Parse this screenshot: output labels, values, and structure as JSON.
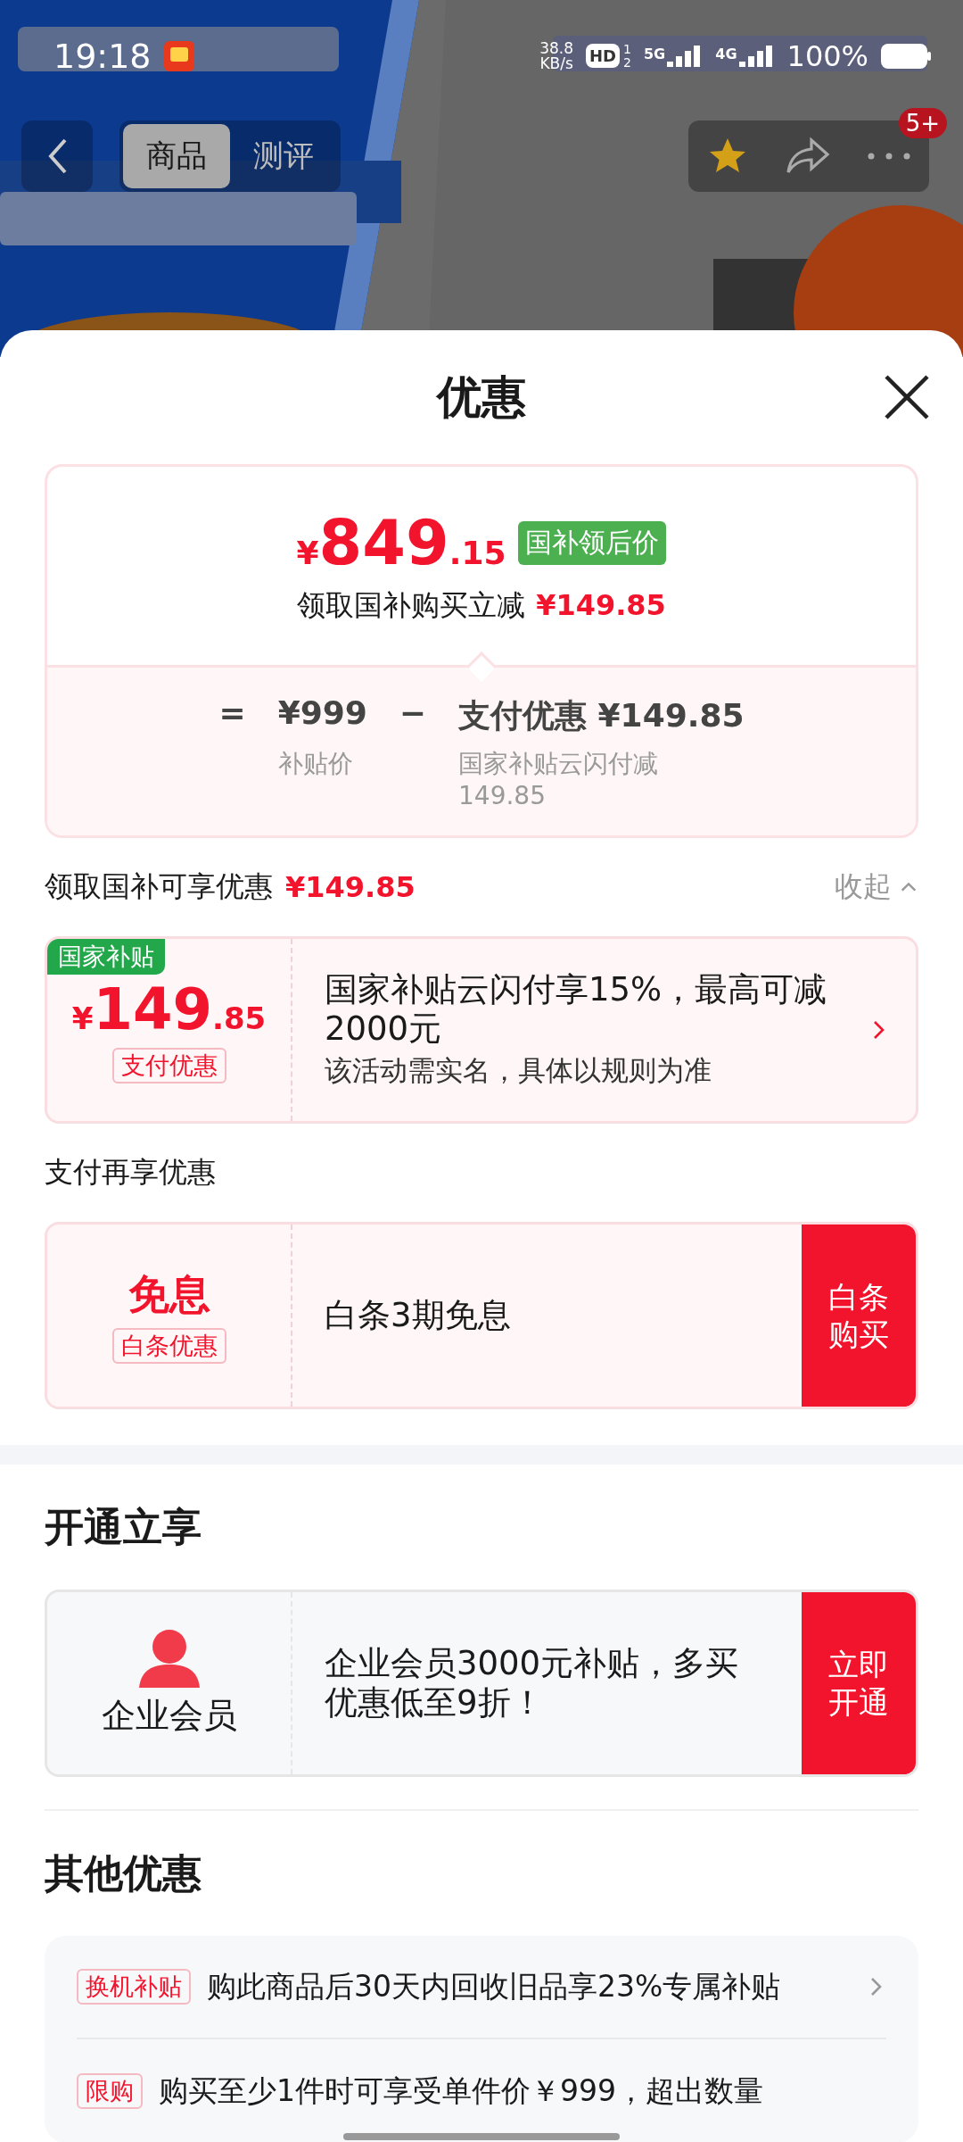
{
  "status_bar": {
    "time": "19:18",
    "net_speed": "38.8",
    "net_unit": "KB/s",
    "hd": "HD",
    "sims": [
      "1",
      "2"
    ],
    "networks": [
      "5G",
      "4G"
    ],
    "battery": "100%"
  },
  "nav": {
    "tabs": [
      {
        "label": "商品",
        "selected": true
      },
      {
        "label": "测评",
        "selected": false
      }
    ],
    "badge": "5+"
  },
  "sheet": {
    "title": "优惠",
    "price_card": {
      "currency": "¥",
      "integer": "849",
      "decimals": ".15",
      "tag": "国补领后价",
      "subtitle": "领取国补购买立减",
      "subtitle_amount": "¥149.85",
      "formula": {
        "equals": "=",
        "base": "¥999",
        "minus": "−",
        "discount": "支付优惠 ¥149.85",
        "base_label": "补贴价",
        "discount_label": "国家补贴云闪付减149.85"
      }
    },
    "summary": {
      "label": "领取国补可享优惠",
      "amount": "¥149.85",
      "toggle": "收起",
      "expanded": true
    },
    "groups": [
      {
        "coupons": [
          {
            "kind": "amount",
            "tag": "国家补贴",
            "currency": "¥",
            "integer": "149",
            "decimals": ".85",
            "label": "支付优惠",
            "title": "国家补贴云闪付享15%，最高可减2000元",
            "desc": "该活动需实名，具体以规则为准"
          }
        ]
      },
      {
        "heading": "支付再享优惠",
        "coupons": [
          {
            "kind": "text",
            "headline": "免息",
            "label": "白条优惠",
            "title": "白条3期免息",
            "action": "白条购买"
          }
        ]
      }
    ],
    "membership": {
      "heading": "开通立享",
      "name": "企业会员",
      "title": "企业会员3000元补贴，多买优惠低至9折！",
      "action": "立即开通"
    },
    "others": {
      "heading": "其他优惠",
      "items": [
        {
          "tag": "换机补贴",
          "text": "购此商品后30天内回收旧品享23%专属补贴",
          "arrow": true
        },
        {
          "tag": "限购",
          "text": "购买至少1件时可享受单件价￥999，超出数量",
          "arrow": false
        }
      ]
    }
  }
}
